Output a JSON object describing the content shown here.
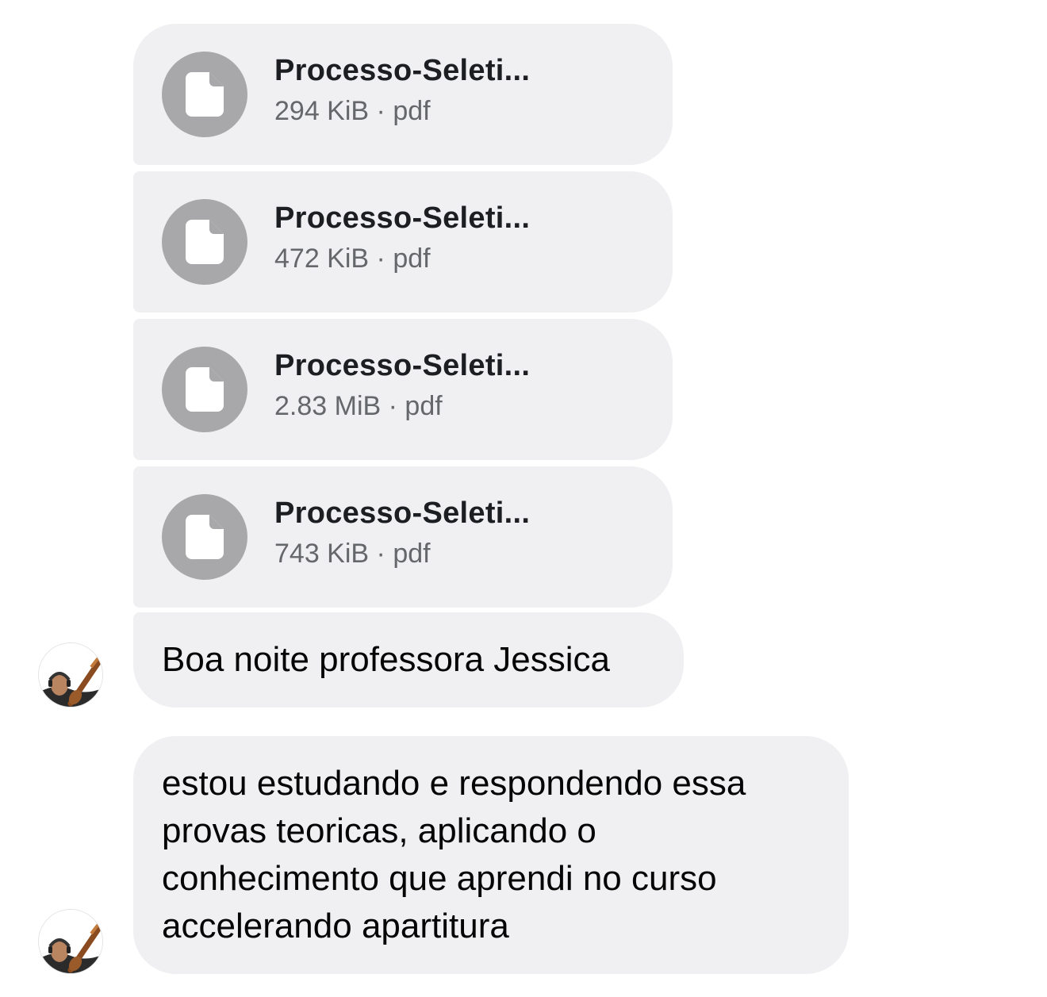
{
  "attachments": [
    {
      "name": "Processo-Seleti...",
      "size": "294 KiB",
      "type": "pdf"
    },
    {
      "name": "Processo-Seleti...",
      "size": "472 KiB",
      "type": "pdf"
    },
    {
      "name": "Processo-Seleti...",
      "size": "2.83 MiB",
      "type": "pdf"
    },
    {
      "name": "Processo-Seleti...",
      "size": "743 KiB",
      "type": "pdf"
    }
  ],
  "messages": [
    {
      "text": "Boa noite professora Jessica"
    },
    {
      "text": "estou estudando e respondendo essa provas teoricas, aplicando o conhecimento que aprendi no curso accelerando apartitura"
    }
  ],
  "separator": " · ",
  "colors": {
    "bubble_bg": "#f0f0f2",
    "icon_bg": "#a8a8aa",
    "meta_text": "#65676b"
  },
  "icons": {
    "file": "file-icon",
    "avatar": "avatar"
  }
}
